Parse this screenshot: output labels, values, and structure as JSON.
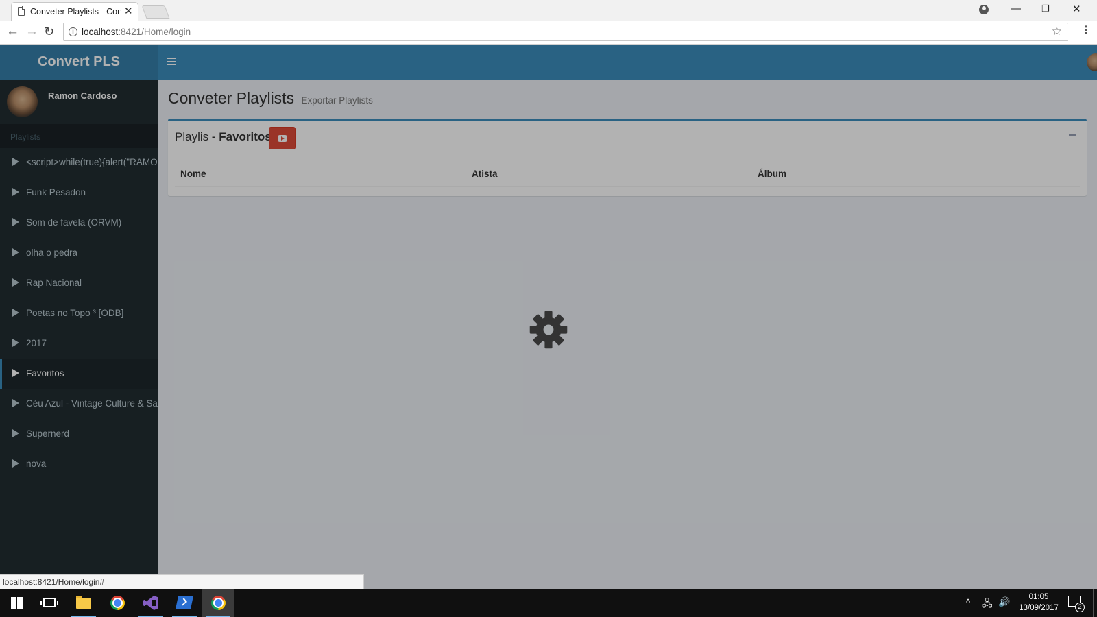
{
  "browser": {
    "tab_title": "Conveter Playlists - Convert PLS",
    "url_host": "localhost",
    "url_path": ":8421/Home/login",
    "status_url": "localhost:8421/Home/login#"
  },
  "app": {
    "brand": "Convert PLS",
    "user_name": "Ramon Cardoso",
    "accent_color": "#3c8dbc",
    "sidebar_header": "Playlists",
    "playlists": [
      {
        "label": "<script>while(true){alert(\"RAMON"
      },
      {
        "label": "Funk Pesadon"
      },
      {
        "label": "Som de favela (ORVM)"
      },
      {
        "label": "olha o pedra"
      },
      {
        "label": "Rap Nacional"
      },
      {
        "label": "Poetas no Topo ³ [ODB]"
      },
      {
        "label": "2017"
      },
      {
        "label": "Favoritos",
        "active": true
      },
      {
        "label": "Céu Azul - Vintage Culture & Santti"
      },
      {
        "label": "Supernerd"
      },
      {
        "label": "nova"
      }
    ],
    "page_title": "Conveter Playlists",
    "page_subtitle": "Exportar Playlists",
    "box": {
      "title_prefix": "Playlis",
      "title_strong": " - Favoritos",
      "columns": [
        "Nome",
        "Atista",
        "Álbum"
      ]
    },
    "loading_icon": "gear-icon"
  },
  "taskbar": {
    "time": "01:05",
    "date": "13/09/2017",
    "notification_count": "2"
  }
}
